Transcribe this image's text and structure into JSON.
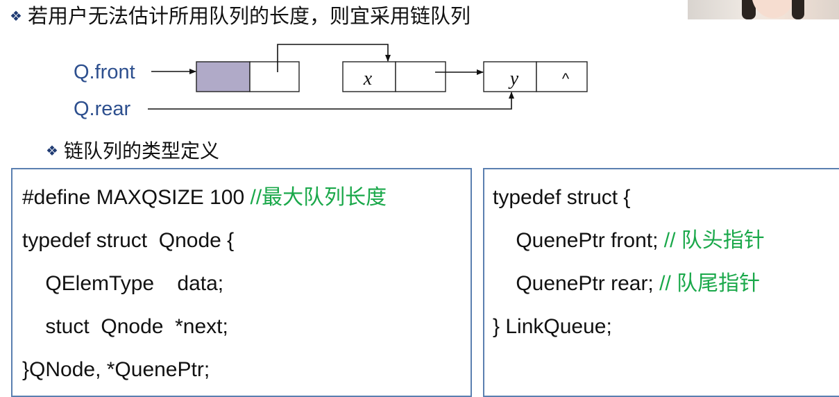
{
  "heading": {
    "bullet": "❖",
    "text": "若用户无法估计所用队列的长度，则宜采用链队列"
  },
  "diagram": {
    "front_label": "Q.front",
    "rear_label": "Q.rear",
    "node_x_value": "x",
    "node_y_value": "y",
    "null_symbol": "^",
    "head_node_fill": "#b0aac8"
  },
  "subheading": {
    "bullet": "❖",
    "text": "链队列的类型定义"
  },
  "code_left": {
    "line1_code": "#define MAXQSIZE 100 ",
    "line1_comment": "//最大队列长度",
    "line2": "typedef struct  Qnode {",
    "line3": "    QElemType    data;",
    "line4": "    stuct  Qnode  *next;",
    "line5": "}QNode, *QuenePtr;"
  },
  "code_right": {
    "line1": "typedef struct {",
    "line2_code": "    QuenePtr front; ",
    "line2_comment": "// 队头指针",
    "line3_code": "    QuenePtr rear; ",
    "line3_comment": "// 队尾指针",
    "line4": "} LinkQueue;"
  },
  "colors": {
    "pointer_label": "#2d4f8e",
    "comment": "#1aa84a",
    "box_border": "#5a7fb0"
  }
}
